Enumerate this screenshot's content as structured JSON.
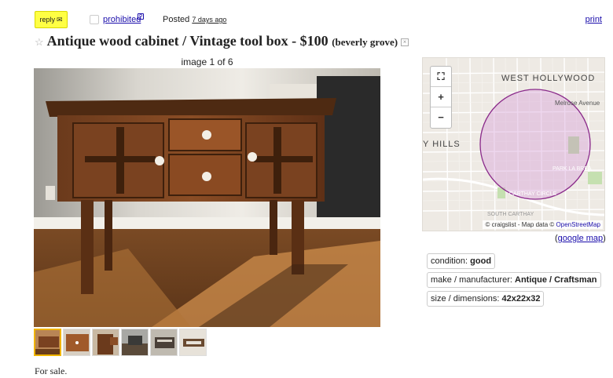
{
  "topbar": {
    "reply_label": "reply",
    "reply_icon": "✉",
    "prohibited_label": "prohibited",
    "prohibited_help": "?",
    "posted_label": "Posted",
    "posted_ago": "7 days ago",
    "print_label": "print"
  },
  "posting": {
    "star": "☆",
    "title": "Antique wood cabinet / Vintage tool box - $100",
    "location": "(beverly grove)",
    "hide_icon": "×",
    "body": "For sale."
  },
  "gallery": {
    "counter": "image 1 of 6",
    "thumb_count": 6,
    "selected_index": 0
  },
  "map": {
    "zoom_in": "+",
    "zoom_out": "−",
    "fullscreen": "⛶",
    "labels": {
      "west_hollywood": "WEST HOLLYWOOD",
      "melrose": "Melrose Avenue",
      "hills": "Y HILLS",
      "park_la_brea": "PARK LA BREA",
      "carthay_circle": "CARTHAY CIRCLE",
      "south_carthay": "SOUTH CARTHAY"
    },
    "attribution_prefix": "© craigslist - Map data ©",
    "attribution_link": "OpenStreetMap",
    "google_open": "(",
    "google_link": "google map",
    "google_close": ")"
  },
  "attributes": [
    {
      "key": "condition:",
      "value": "good"
    },
    {
      "key": "make / manufacturer:",
      "value": "Antique / Craftsman"
    },
    {
      "key": "size / dimensions:",
      "value": "42x22x32"
    }
  ],
  "colors": {
    "link": "#1a0dab",
    "reply_bg": "#ffff44",
    "radius_fill": "#d49bd6",
    "radius_stroke": "#8a2a8a"
  }
}
